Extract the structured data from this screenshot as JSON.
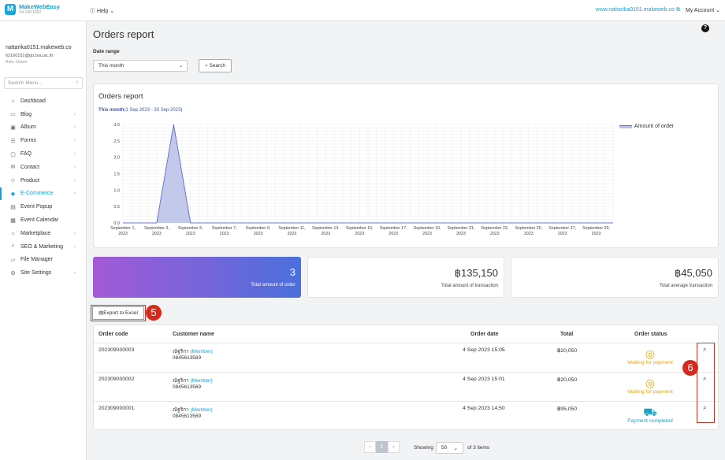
{
  "app": {
    "name": "MakeWebEasy",
    "version": "V4.148.1852"
  },
  "topbar": {
    "help": "Help",
    "site_url": "www.nattarika0151.makeweb.co",
    "account": "My Account"
  },
  "user": {
    "name": "nattarika0151.makeweb.co",
    "email": "62160151@go.buu.ac.th",
    "role": "Role: Owner"
  },
  "sidebar": {
    "search_placeholder": "Search Menu...",
    "items": [
      {
        "label": "Dashboad",
        "icon": "home-icon"
      },
      {
        "label": "Blog",
        "icon": "blog-icon"
      },
      {
        "label": "Album",
        "icon": "album-icon"
      },
      {
        "label": "Forms",
        "icon": "forms-icon"
      },
      {
        "label": "FAQ",
        "icon": "faq-icon"
      },
      {
        "label": "Contact",
        "icon": "contact-icon"
      },
      {
        "label": "Product",
        "icon": "product-icon"
      },
      {
        "label": "E-Commerce",
        "icon": "tag-icon"
      },
      {
        "label": "Event Popup",
        "icon": "popup-icon"
      },
      {
        "label": "Event Calendar",
        "icon": "calendar-icon"
      },
      {
        "label": "Marketplace",
        "icon": "marketplace-icon"
      },
      {
        "label": "SEO & Marketing",
        "icon": "seo-icon"
      },
      {
        "label": "File Manager",
        "icon": "folder-icon"
      },
      {
        "label": "Site Settings",
        "icon": "gear-icon"
      }
    ]
  },
  "page": {
    "title": "Orders report"
  },
  "filter": {
    "label": "Date range",
    "selected": "This month",
    "search_label": "Search"
  },
  "chart_card": {
    "title": "Orders report",
    "range_label": "This month",
    "range_dates": "(1 Sep 2023 - 30 Sep 2023)"
  },
  "chart_data": {
    "type": "area",
    "series": [
      {
        "name": "Amount of order",
        "color": "#6a77c8"
      }
    ],
    "x_ticks": [
      [
        "September 1,",
        "2023"
      ],
      [
        "September 3,",
        "2023"
      ],
      [
        "September 5,",
        "2023"
      ],
      [
        "September 7,",
        "2023"
      ],
      [
        "September 9,",
        "2023"
      ],
      [
        "September 11,",
        "2023"
      ],
      [
        "September 13,",
        "2023"
      ],
      [
        "September 15,",
        "2023"
      ],
      [
        "September 17,",
        "2023"
      ],
      [
        "September 19,",
        "2023"
      ],
      [
        "September 21,",
        "2023"
      ],
      [
        "September 23,",
        "2023"
      ],
      [
        "September 25,",
        "2023"
      ],
      [
        "September 27,",
        "2023"
      ],
      [
        "September 29,",
        "2023"
      ]
    ],
    "y_ticks": [
      "3.0",
      "2.5",
      "2.0",
      "1.5",
      "1.0",
      "0.5",
      "0.0"
    ],
    "ylim": [
      0,
      3
    ],
    "xlim": [
      1,
      30
    ],
    "points": [
      [
        1,
        0
      ],
      [
        2,
        0
      ],
      [
        3,
        0
      ],
      [
        4,
        3
      ],
      [
        5,
        0
      ],
      [
        6,
        0
      ],
      [
        7,
        0
      ],
      [
        8,
        0
      ],
      [
        9,
        0
      ],
      [
        10,
        0
      ],
      [
        11,
        0
      ],
      [
        12,
        0
      ],
      [
        13,
        0
      ],
      [
        14,
        0
      ],
      [
        15,
        0
      ],
      [
        16,
        0
      ],
      [
        17,
        0
      ],
      [
        18,
        0
      ],
      [
        19,
        0
      ],
      [
        20,
        0
      ],
      [
        21,
        0
      ],
      [
        22,
        0
      ],
      [
        23,
        0
      ],
      [
        24,
        0
      ],
      [
        25,
        0
      ],
      [
        26,
        0
      ],
      [
        27,
        0
      ],
      [
        28,
        0
      ],
      [
        29,
        0
      ],
      [
        30,
        0
      ]
    ],
    "legend_position": "top-right",
    "grid": true
  },
  "stats": [
    {
      "value": "3",
      "label": "Total amount of order"
    },
    {
      "value": "฿135,150",
      "label": "Total amount of transaction"
    },
    {
      "value": "฿45,050",
      "label": "Total average transaction"
    }
  ],
  "export_label": "Export to Excel",
  "annotations": [
    "5",
    "6"
  ],
  "table": {
    "headers": {
      "code": "Order code",
      "customer": "Customer name",
      "date": "Order date",
      "total": "Total",
      "status": "Order status"
    },
    "rows": [
      {
        "code": "202309000003",
        "customer": "ณัฐริกา",
        "member": "(Member)",
        "phone": "0845613569",
        "date": "4 Sep 2023 15:05",
        "total": "฿20,050",
        "status": "Waiting for payment"
      },
      {
        "code": "202309000002",
        "customer": "ณัฐริกา",
        "member": "(Member)",
        "phone": "0845613569",
        "date": "4 Sep 2023 15:01",
        "total": "฿20,050",
        "status": "Waiting for payment"
      },
      {
        "code": "202309000001",
        "customer": "ณัฐริกา",
        "member": "(Member)",
        "phone": "0845613569",
        "date": "4 Sep 2023 14:50",
        "total": "฿95,050",
        "status": "Payment completed"
      }
    ]
  },
  "pagination": {
    "prev": "‹",
    "current": "1",
    "next": "›",
    "showing": "Showing",
    "per_page": "50",
    "of_items": "of 3 items"
  }
}
